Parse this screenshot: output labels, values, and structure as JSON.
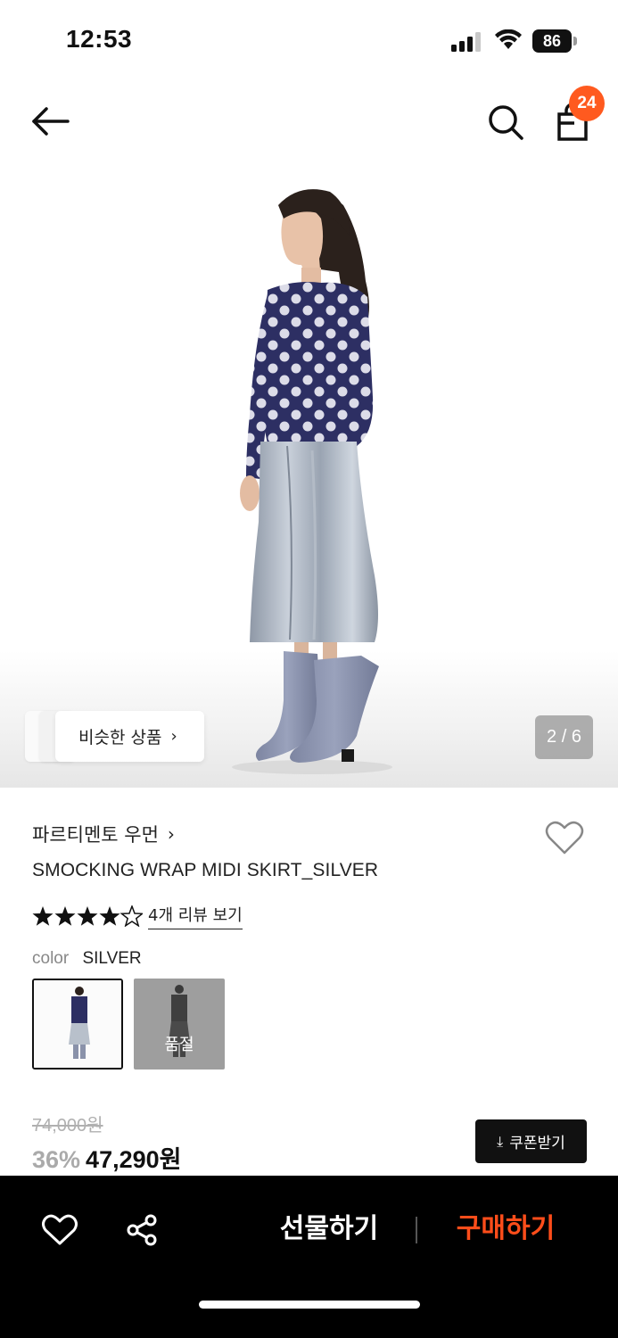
{
  "status_bar": {
    "time": "12:53",
    "battery": "86"
  },
  "nav": {
    "cart_count": "24"
  },
  "gallery": {
    "similar_label": "비슷한 상품",
    "page_indicator": "2 / 6"
  },
  "product": {
    "brand": "파르티멘토 우먼",
    "name": "SMOCKING WRAP MIDI SKIRT_SILVER",
    "rating": 4.5,
    "review_link": "4개 리뷰 보기",
    "color_label": "color",
    "color_value": "SILVER",
    "swatches": [
      {
        "selected": true,
        "sold_out_text": ""
      },
      {
        "selected": false,
        "sold_out_text": "품절"
      }
    ],
    "original_price": "74,000원",
    "discount": "36%",
    "price": "47,290원",
    "coupon_label": "쿠폰받기"
  },
  "bottom_bar": {
    "gift_label": "선물하기",
    "buy_label": "구매하기"
  },
  "colors": {
    "accent": "#ff4d1a",
    "badge": "#ff5a1f"
  }
}
